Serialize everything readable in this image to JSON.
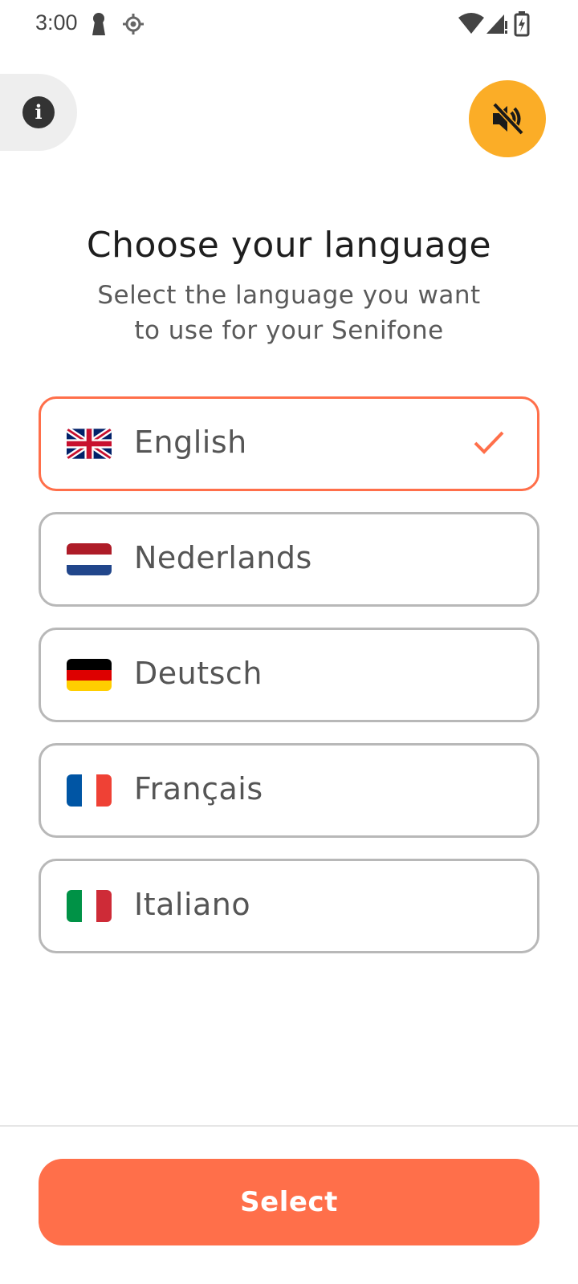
{
  "status_bar": {
    "time": "3:00",
    "icons": [
      "keyhole-icon",
      "location-target-icon",
      "wifi-icon",
      "signal-icon",
      "battery-charging-icon"
    ]
  },
  "header": {
    "info_icon": "info-icon",
    "mute_icon": "volume-off-icon",
    "mute_color": "#fbad27"
  },
  "main": {
    "title": "Choose your language",
    "subtitle_line1": "Select the language you want",
    "subtitle_line2": "to use for your Senifone"
  },
  "languages": [
    {
      "label": "English",
      "flag": "uk-flag-icon",
      "selected": true
    },
    {
      "label": "Nederlands",
      "flag": "netherlands-flag-icon",
      "selected": false
    },
    {
      "label": "Deutsch",
      "flag": "germany-flag-icon",
      "selected": false
    },
    {
      "label": "Français",
      "flag": "france-flag-icon",
      "selected": false
    },
    {
      "label": "Italiano",
      "flag": "italy-flag-icon",
      "selected": false
    }
  ],
  "footer": {
    "select_label": "Select"
  },
  "colors": {
    "accent": "#ff6f4a",
    "mute_button": "#fbad27",
    "border": "#b8b8b8"
  }
}
